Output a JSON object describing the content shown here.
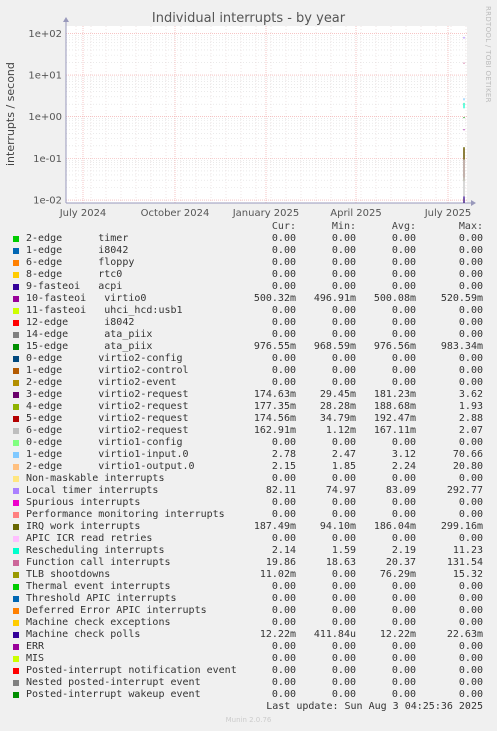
{
  "chart_data": {
    "type": "line",
    "title": "Individual interrupts - by year",
    "ylabel": "interrupts / second",
    "yscale": "log",
    "ylim": [
      0.0085,
      150
    ],
    "yticks": [
      "1e+02",
      "1e+01",
      "1e+00",
      "1e-01",
      "1e-02"
    ],
    "xticks": [
      "July 2024",
      "October 2024",
      "January 2025",
      "April 2025",
      "July 2025"
    ],
    "grid": true,
    "columns": [
      "Cur:",
      "Min:",
      "Avg:",
      "Max:"
    ],
    "series": [
      {
        "name": "2-edge      timer",
        "color": "#00cc00",
        "cur": "0.00",
        "min": "0.00",
        "avg": "0.00",
        "max": "0.00"
      },
      {
        "name": "1-edge      i8042",
        "color": "#0066b3",
        "cur": "0.00",
        "min": "0.00",
        "avg": "0.00",
        "max": "0.00"
      },
      {
        "name": "6-edge      floppy",
        "color": "#ff8000",
        "cur": "0.00",
        "min": "0.00",
        "avg": "0.00",
        "max": "0.00"
      },
      {
        "name": "8-edge      rtc0",
        "color": "#ffcc00",
        "cur": "0.00",
        "min": "0.00",
        "avg": "0.00",
        "max": "0.00"
      },
      {
        "name": "9-fasteoi   acpi",
        "color": "#330099",
        "cur": "0.00",
        "min": "0.00",
        "avg": "0.00",
        "max": "0.00"
      },
      {
        "name": "10-fasteoi   virtio0",
        "color": "#990099",
        "cur": "500.32m",
        "min": "496.91m",
        "avg": "500.08m",
        "max": "520.59m"
      },
      {
        "name": "11-fasteoi   uhci_hcd:usb1",
        "color": "#ccff00",
        "cur": "0.00",
        "min": "0.00",
        "avg": "0.00",
        "max": "0.00"
      },
      {
        "name": "12-edge      i8042",
        "color": "#ff0000",
        "cur": "0.00",
        "min": "0.00",
        "avg": "0.00",
        "max": "0.00"
      },
      {
        "name": "14-edge      ata_piix",
        "color": "#808080",
        "cur": "0.00",
        "min": "0.00",
        "avg": "0.00",
        "max": "0.00"
      },
      {
        "name": "15-edge      ata_piix",
        "color": "#008f00",
        "cur": "976.55m",
        "min": "968.59m",
        "avg": "976.56m",
        "max": "983.34m"
      },
      {
        "name": "0-edge      virtio2-config",
        "color": "#00487d",
        "cur": "0.00",
        "min": "0.00",
        "avg": "0.00",
        "max": "0.00"
      },
      {
        "name": "1-edge      virtio2-control",
        "color": "#b35a00",
        "cur": "0.00",
        "min": "0.00",
        "avg": "0.00",
        "max": "0.00"
      },
      {
        "name": "2-edge      virtio2-event",
        "color": "#b38f00",
        "cur": "0.00",
        "min": "0.00",
        "avg": "0.00",
        "max": "0.00"
      },
      {
        "name": "3-edge      virtio2-request",
        "color": "#6b006b",
        "cur": "174.63m",
        "min": "29.45m",
        "avg": "181.23m",
        "max": "3.62"
      },
      {
        "name": "4-edge      virtio2-request",
        "color": "#8fb300",
        "cur": "177.35m",
        "min": "28.28m",
        "avg": "188.68m",
        "max": "1.93"
      },
      {
        "name": "5-edge      virtio2-request",
        "color": "#b30000",
        "cur": "174.56m",
        "min": "34.79m",
        "avg": "192.47m",
        "max": "2.88"
      },
      {
        "name": "6-edge      virtio2-request",
        "color": "#bebebe",
        "cur": "162.91m",
        "min": "1.12m",
        "avg": "167.11m",
        "max": "2.07"
      },
      {
        "name": "0-edge      virtio1-config",
        "color": "#80ff80",
        "cur": "0.00",
        "min": "0.00",
        "avg": "0.00",
        "max": "0.00"
      },
      {
        "name": "1-edge      virtio1-input.0",
        "color": "#80c9ff",
        "cur": "2.78",
        "min": "2.47",
        "avg": "3.12",
        "max": "70.66"
      },
      {
        "name": "2-edge      virtio1-output.0",
        "color": "#ffc080",
        "cur": "2.15",
        "min": "1.85",
        "avg": "2.24",
        "max": "20.80"
      },
      {
        "name": "Non-maskable interrupts",
        "color": "#ffe680",
        "cur": "0.00",
        "min": "0.00",
        "avg": "0.00",
        "max": "0.00"
      },
      {
        "name": "Local timer interrupts",
        "color": "#aa80ff",
        "cur": "82.11",
        "min": "74.97",
        "avg": "83.09",
        "max": "292.77"
      },
      {
        "name": "Spurious interrupts",
        "color": "#ee00cc",
        "cur": "0.00",
        "min": "0.00",
        "avg": "0.00",
        "max": "0.00"
      },
      {
        "name": "Performance monitoring interrupts",
        "color": "#ff8080",
        "cur": "0.00",
        "min": "0.00",
        "avg": "0.00",
        "max": "0.00"
      },
      {
        "name": "IRQ work interrupts",
        "color": "#666600",
        "cur": "187.49m",
        "min": "94.10m",
        "avg": "186.04m",
        "max": "299.16m"
      },
      {
        "name": "APIC ICR read retries",
        "color": "#ffbfff",
        "cur": "0.00",
        "min": "0.00",
        "avg": "0.00",
        "max": "0.00"
      },
      {
        "name": "Rescheduling interrupts",
        "color": "#00ffcc",
        "cur": "2.14",
        "min": "1.59",
        "avg": "2.19",
        "max": "11.23"
      },
      {
        "name": "Function call interrupts",
        "color": "#cc6699",
        "cur": "19.86",
        "min": "18.63",
        "avg": "20.37",
        "max": "131.54"
      },
      {
        "name": "TLB shootdowns",
        "color": "#999900",
        "cur": "11.02m",
        "min": "0.00",
        "avg": "76.29m",
        "max": "15.32"
      },
      {
        "name": "Thermal event interrupts",
        "color": "#00cc00",
        "cur": "0.00",
        "min": "0.00",
        "avg": "0.00",
        "max": "0.00"
      },
      {
        "name": "Threshold APIC interrupts",
        "color": "#0066b3",
        "cur": "0.00",
        "min": "0.00",
        "avg": "0.00",
        "max": "0.00"
      },
      {
        "name": "Deferred Error APIC interrupts",
        "color": "#ff8000",
        "cur": "0.00",
        "min": "0.00",
        "avg": "0.00",
        "max": "0.00"
      },
      {
        "name": "Machine check exceptions",
        "color": "#ffcc00",
        "cur": "0.00",
        "min": "0.00",
        "avg": "0.00",
        "max": "0.00"
      },
      {
        "name": "Machine check polls",
        "color": "#330099",
        "cur": "12.22m",
        "min": "411.84u",
        "avg": "12.22m",
        "max": "22.63m"
      },
      {
        "name": "ERR",
        "color": "#990099",
        "cur": "0.00",
        "min": "0.00",
        "avg": "0.00",
        "max": "0.00"
      },
      {
        "name": "MIS",
        "color": "#ccff00",
        "cur": "0.00",
        "min": "0.00",
        "avg": "0.00",
        "max": "0.00"
      },
      {
        "name": "Posted-interrupt notification event",
        "color": "#ff0000",
        "cur": "0.00",
        "min": "0.00",
        "avg": "0.00",
        "max": "0.00"
      },
      {
        "name": "Nested posted-interrupt event",
        "color": "#808080",
        "cur": "0.00",
        "min": "0.00",
        "avg": "0.00",
        "max": "0.00"
      },
      {
        "name": "Posted-interrupt wakeup event",
        "color": "#008f00",
        "cur": "0.00",
        "min": "0.00",
        "avg": "0.00",
        "max": "0.00"
      }
    ]
  },
  "side_text": "RRDTOOL / TOBI OETIKER",
  "last_update": "Last update: Sun Aug  3 04:25:36 2025",
  "footer": "Munin 2.0.76"
}
